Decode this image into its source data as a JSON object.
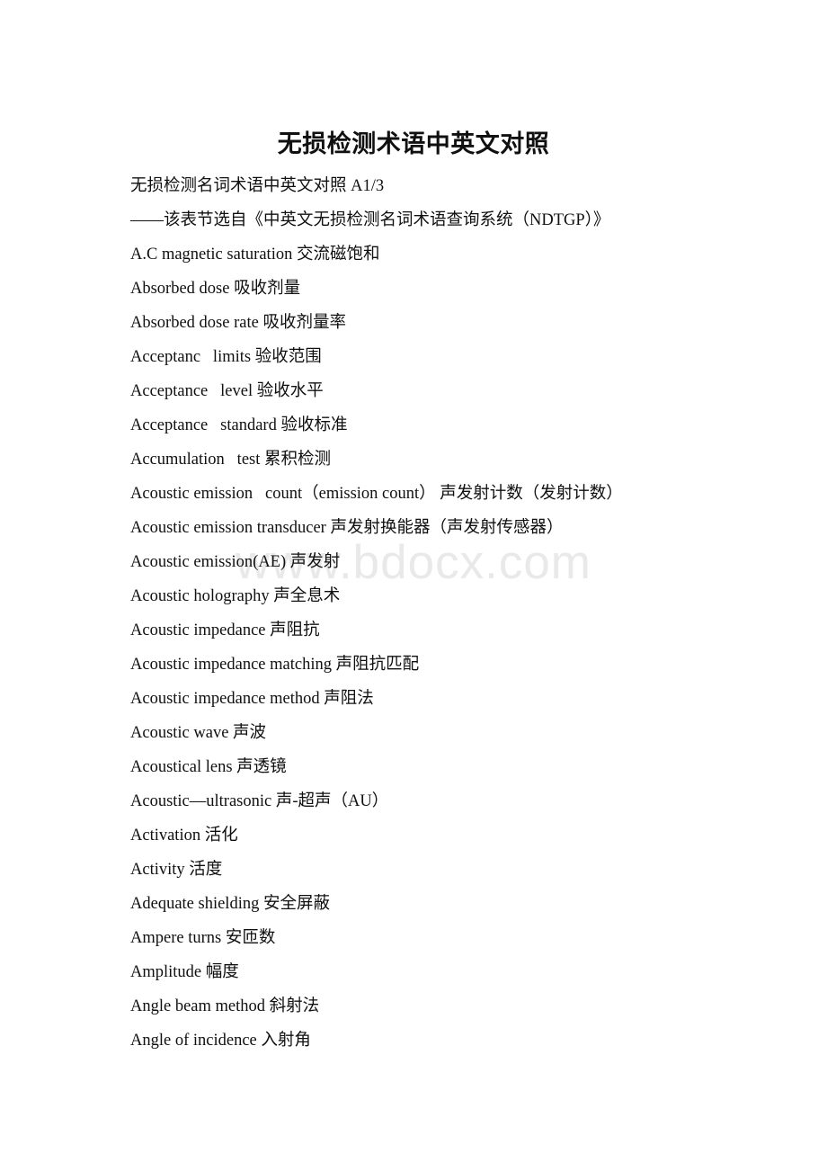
{
  "document": {
    "title": "无损检测术语中英文对照",
    "watermark": "www.bdocx.com",
    "lines": [
      "无损检测名词术语中英文对照 A1/3",
      "——该表节选自《中英文无损检测名词术语查询系统（NDTGP）》",
      "A.C magnetic saturation 交流磁饱和",
      "Absorbed dose 吸收剂量",
      "Absorbed dose rate 吸收剂量率",
      "Acceptanc   limits 验收范围",
      "Acceptance   level 验收水平",
      "Acceptance   standard 验收标准",
      "Accumulation   test 累积检测",
      "Acoustic emission   count（emission count） 声发射计数（发射计数）",
      "Acoustic emission transducer 声发射换能器（声发射传感器）",
      "Acoustic emission(AE) 声发射",
      "Acoustic holography 声全息术",
      "Acoustic impedance 声阻抗",
      "Acoustic impedance matching 声阻抗匹配",
      "Acoustic impedance method 声阻法",
      "Acoustic wave 声波",
      "Acoustical lens 声透镜",
      "Acoustic—ultrasonic 声-超声（AU）",
      "Activation 活化",
      "Activity 活度",
      "Adequate shielding 安全屏蔽",
      "Ampere turns 安匝数",
      "Amplitude 幅度",
      "Angle beam method 斜射法",
      "Angle of incidence 入射角"
    ]
  }
}
